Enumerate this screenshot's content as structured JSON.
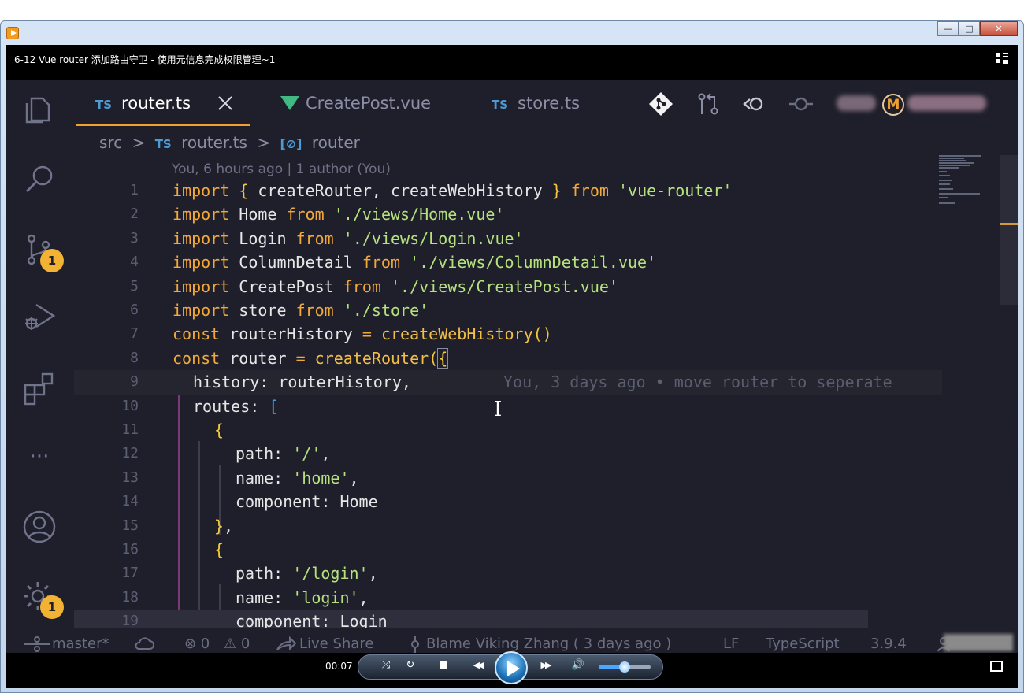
{
  "player": {
    "title": "6-12 Vue router 添加路由守卫 - 使用元信息完成权限管理~1",
    "time": "00:07",
    "volume": 0.5,
    "window_buttons": {
      "minimize": "—",
      "maximize": "□",
      "close": "✕"
    },
    "controls": {
      "shuffle": "⤮",
      "repeat": "↻",
      "stop": "■",
      "rewind": "◀◀",
      "forward": "▶▶",
      "volume": "🔊"
    }
  },
  "editor": {
    "tabs": [
      {
        "lang": "TS",
        "label": "router.ts",
        "active": true
      },
      {
        "lang": "",
        "label": "CreatePost.vue",
        "active": false
      },
      {
        "lang": "TS",
        "label": "store.ts",
        "active": false
      }
    ],
    "breadcrumb": {
      "folder": "src",
      "sep": ">",
      "file_lang": "TS",
      "file": "router.ts",
      "symbol_icon": "[⊘]",
      "symbol": "router"
    },
    "blame_header": "You, 6 hours ago | 1 author (You)",
    "inline_blame": "You, 3 days ago • move router to seperate",
    "badges": {
      "source_control": "1",
      "settings": "1"
    },
    "more_icon": "···",
    "lines": [
      {
        "n": "1"
      },
      {
        "n": "2"
      },
      {
        "n": "3"
      },
      {
        "n": "4"
      },
      {
        "n": "5"
      },
      {
        "n": "6"
      },
      {
        "n": "7"
      },
      {
        "n": "8"
      },
      {
        "n": "9"
      },
      {
        "n": "10"
      },
      {
        "n": "11"
      },
      {
        "n": "12"
      },
      {
        "n": "13"
      },
      {
        "n": "14"
      },
      {
        "n": "15"
      },
      {
        "n": "16"
      },
      {
        "n": "17"
      },
      {
        "n": "18"
      },
      {
        "n": "19"
      }
    ],
    "tokens": {
      "import": "import",
      "from": "from",
      "const": "const",
      "l1_mid": "createRouter, createWebHistory",
      "l1_str": "'vue-router'",
      "l2_id": "Home",
      "l2_str": "'./views/Home.vue'",
      "l3_id": "Login",
      "l3_str": "'./views/Login.vue'",
      "l4_id": "ColumnDetail",
      "l4_str": "'./views/ColumnDetail.vue'",
      "l5_id": "CreatePost",
      "l5_str": "'./views/CreatePost.vue'",
      "l6_id": "store",
      "l6_str": "'./store'",
      "l7_id": "routerHistory",
      "l7_fn": "createWebHistory",
      "l8_id": "router",
      "l8_fn": "createRouter",
      "eq": "=",
      "parens": "()",
      "open_paren": "(",
      "lbrace": "{",
      "rbrace": "}",
      "lbrace_sp": "{ ",
      "rbrace_sp": " }",
      "lbracket": "[",
      "comma": ",",
      "l9": "history: routerHistory,",
      "l10": "routes:",
      "path_key": "path: ",
      "name_key": "name: ",
      "component_key": "component: ",
      "p_home": "'/'",
      "n_home": "'home'",
      "c_home": "Home",
      "p_login": "'/login'",
      "n_login": "'login'",
      "c_login": "Login"
    },
    "status": {
      "branch": "master*",
      "errors": "⊗ 0",
      "warnings": "⚠ 0",
      "live_share": "Live Share",
      "blame": "Blame Viking Zhang ( 3 days ago )",
      "eol": "LF",
      "language": "TypeScript",
      "version": "3.9.4"
    }
  },
  "colors": {
    "editor_bg": "#1f1f2b",
    "keyword": "#f3a93a",
    "string": "#b6e27e",
    "accent": "#f0a130",
    "badge": "#f2b234"
  }
}
